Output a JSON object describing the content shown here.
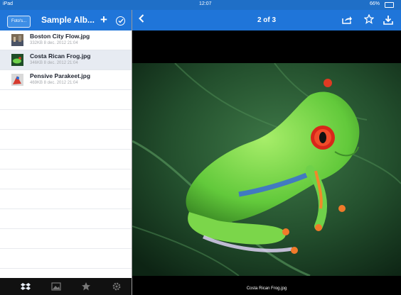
{
  "status": {
    "device": "iPad",
    "time": "12:07",
    "battery": "66%"
  },
  "sidebar": {
    "back_label": "Foto's...",
    "title": "Sample Alb...",
    "add_label": "+",
    "files": [
      {
        "name": "Boston City Flow.jpg",
        "meta": "332KB  8 dec. 2012 21:04",
        "selected": false
      },
      {
        "name": "Costa Rican Frog.jpg",
        "meta": "346KB  8 dec. 2012 21:04",
        "selected": true
      },
      {
        "name": "Pensive Parakeet.jpg",
        "meta": "469KB  8 dec. 2012 21:04",
        "selected": false
      }
    ],
    "tabs": [
      "dropbox-icon",
      "photos-icon",
      "favorites-icon",
      "settings-icon"
    ]
  },
  "viewer": {
    "counter": "2 of 3",
    "caption": "Costa Rican Frog.jpg",
    "icons": [
      "back-chevron-icon",
      "share-icon",
      "star-icon",
      "download-icon"
    ]
  },
  "colors": {
    "accent": "#1f75d9",
    "selected_row": "#e7ebf2",
    "tabbar": "#111111"
  }
}
